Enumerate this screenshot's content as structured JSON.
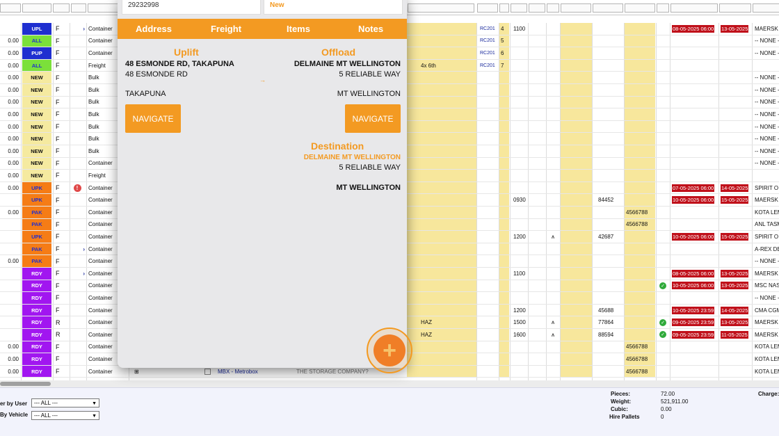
{
  "grid_rows": [
    {
      "amount": "",
      "status": "UPL",
      "status_bg": "#1f2fd0",
      "status_color": "#ffffff",
      "type": "F",
      "flag": "arrow",
      "category": "Container",
      "rc": "RC201",
      "n": "4",
      "time": "1100",
      "ref": "",
      "ref2": "",
      "check": false,
      "haz": false,
      "date1": "08-05-2025 06:00",
      "date2": "13-05-2025",
      "carrier": "MAERSK I"
    },
    {
      "amount": "0.00",
      "status": "ALL",
      "status_bg": "#7be03a",
      "status_color": "#1f2fd0",
      "type": "F",
      "flag": "",
      "category": "Container",
      "rc": "RC201",
      "n": "5",
      "time": "",
      "ref": "",
      "ref2": "",
      "check": false,
      "haz": false,
      "date1": "",
      "date2": "",
      "carrier": "-- NONE -"
    },
    {
      "amount": "0.00",
      "status": "PUP",
      "status_bg": "#1f2fd0",
      "status_color": "#ffffff",
      "type": "F",
      "flag": "",
      "category": "Container",
      "rc": "RC201",
      "n": "6",
      "time": "",
      "ref": "",
      "ref2": "",
      "check": false,
      "haz": false,
      "date1": "",
      "date2": "",
      "carrier": "-- NONE -"
    },
    {
      "amount": "0.00",
      "status": "ALL",
      "status_bg": "#7be03a",
      "status_color": "#1f2fd0",
      "type": "F",
      "flag": "",
      "category": "Freight",
      "extra": "4x 6th",
      "rc": "RC201",
      "n": "7",
      "time": "",
      "ref": "",
      "ref2": "",
      "check": false,
      "haz": false,
      "date1": "",
      "date2": "",
      "carrier": ""
    },
    {
      "amount": "0.00",
      "status": "NEW",
      "status_bg": "#f5eaa0",
      "status_color": "#111111",
      "type": "F",
      "flag": "",
      "category": "Bulk",
      "rc": "",
      "n": "",
      "time": "",
      "ref": "",
      "ref2": "",
      "check": false,
      "haz": false,
      "date1": "",
      "date2": "",
      "carrier": "-- NONE -"
    },
    {
      "amount": "0.00",
      "status": "NEW",
      "status_bg": "#f5eaa0",
      "status_color": "#111111",
      "type": "F",
      "flag": "",
      "category": "Bulk",
      "rc": "",
      "n": "",
      "time": "",
      "ref": "",
      "ref2": "",
      "check": false,
      "haz": false,
      "date1": "",
      "date2": "",
      "carrier": "-- NONE -"
    },
    {
      "amount": "0.00",
      "status": "NEW",
      "status_bg": "#f5eaa0",
      "status_color": "#111111",
      "type": "F",
      "flag": "",
      "category": "Bulk",
      "rc": "",
      "n": "",
      "time": "",
      "ref": "",
      "ref2": "",
      "check": false,
      "haz": false,
      "date1": "",
      "date2": "",
      "carrier": "-- NONE -"
    },
    {
      "amount": "0.00",
      "status": "NEW",
      "status_bg": "#f5eaa0",
      "status_color": "#111111",
      "type": "F",
      "flag": "",
      "category": "Bulk",
      "rc": "",
      "n": "",
      "time": "",
      "ref": "",
      "ref2": "",
      "check": false,
      "haz": false,
      "date1": "",
      "date2": "",
      "carrier": "-- NONE -"
    },
    {
      "amount": "0.00",
      "status": "NEW",
      "status_bg": "#f5eaa0",
      "status_color": "#111111",
      "type": "F",
      "flag": "",
      "category": "Bulk",
      "rc": "",
      "n": "",
      "time": "",
      "ref": "",
      "ref2": "",
      "check": false,
      "haz": false,
      "date1": "",
      "date2": "",
      "carrier": "-- NONE -"
    },
    {
      "amount": "0.00",
      "status": "NEW",
      "status_bg": "#f5eaa0",
      "status_color": "#111111",
      "type": "F",
      "flag": "",
      "category": "Bulk",
      "rc": "",
      "n": "",
      "time": "",
      "ref": "",
      "ref2": "",
      "check": false,
      "haz": false,
      "date1": "",
      "date2": "",
      "carrier": "-- NONE -"
    },
    {
      "amount": "0.00",
      "status": "NEW",
      "status_bg": "#f5eaa0",
      "status_color": "#111111",
      "type": "F",
      "flag": "",
      "category": "Bulk",
      "rc": "",
      "n": "",
      "time": "",
      "ref": "",
      "ref2": "",
      "check": false,
      "haz": false,
      "date1": "",
      "date2": "",
      "carrier": "-- NONE -"
    },
    {
      "amount": "0.00",
      "status": "NEW",
      "status_bg": "#f5eaa0",
      "status_color": "#111111",
      "type": "F",
      "flag": "",
      "category": "Container",
      "rc": "",
      "n": "",
      "time": "",
      "ref": "",
      "ref2": "",
      "check": false,
      "haz": false,
      "date1": "",
      "date2": "",
      "carrier": "-- NONE -"
    },
    {
      "amount": "0.00",
      "status": "NEW",
      "status_bg": "#f5eaa0",
      "status_color": "#111111",
      "type": "F",
      "flag": "",
      "category": "Freight",
      "rc": "",
      "n": "",
      "time": "",
      "ref": "",
      "ref2": "",
      "check": false,
      "haz": false,
      "date1": "",
      "date2": "",
      "carrier": ""
    },
    {
      "amount": "0.00",
      "status": "UPK",
      "status_bg": "#f57c16",
      "status_color": "#1f2fd0",
      "type": "F",
      "flag": "alert",
      "category": "Container",
      "rc": "",
      "n": "",
      "time": "",
      "ref": "",
      "ref2": "",
      "check": false,
      "haz": false,
      "date1": "07-05-2025 06:00",
      "date2": "14-05-2025",
      "carrier": "SPIRIT O"
    },
    {
      "amount": "",
      "status": "UPK",
      "status_bg": "#f57c16",
      "status_color": "#1f2fd0",
      "type": "F",
      "flag": "",
      "category": "Container",
      "rc": "",
      "n": "",
      "time": "0930",
      "ref": "84452",
      "ref2": "",
      "check": false,
      "haz": false,
      "date1": "10-05-2025 06:00",
      "date2": "15-05-2025",
      "carrier": "MAERSK V"
    },
    {
      "amount": "0.00",
      "status": "PAK",
      "status_bg": "#f57c16",
      "status_color": "#1f2fd0",
      "type": "F",
      "flag": "",
      "category": "Container",
      "rc": "",
      "n": "",
      "time": "",
      "ref": "",
      "ref2": "4566788",
      "check": false,
      "haz": false,
      "date1": "",
      "date2": "",
      "carrier": "KOTA LEM"
    },
    {
      "amount": "",
      "status": "PAK",
      "status_bg": "#f57c16",
      "status_color": "#1f2fd0",
      "type": "F",
      "flag": "",
      "category": "Container",
      "rc": "",
      "n": "",
      "time": "",
      "ref": "",
      "ref2": "4566788",
      "check": false,
      "haz": false,
      "date1": "",
      "date2": "",
      "carrier": "ANL TASM"
    },
    {
      "amount": "",
      "status": "UPK",
      "status_bg": "#f57c16",
      "status_color": "#1f2fd0",
      "type": "F",
      "flag": "",
      "category": "Container",
      "rc": "",
      "n": "",
      "time": "1200",
      "ref": "42687",
      "ref2": "",
      "check": false,
      "haz": true,
      "date1": "10-05-2025 06:00",
      "date2": "15-05-2025",
      "carrier": "SPIRIT O"
    },
    {
      "amount": "",
      "status": "PAK",
      "status_bg": "#f57c16",
      "status_color": "#1f2fd0",
      "type": "F",
      "flag": "arrow",
      "category": "Container",
      "rc": "",
      "n": "",
      "time": "",
      "ref": "",
      "ref2": "",
      "check": false,
      "haz": false,
      "date1": "",
      "date2": "",
      "carrier": "A-REX DE"
    },
    {
      "amount": "0.00",
      "status": "PAK",
      "status_bg": "#f57c16",
      "status_color": "#1f2fd0",
      "type": "F",
      "flag": "",
      "category": "Container",
      "rc": "",
      "n": "",
      "time": "",
      "ref": "",
      "ref2": "",
      "check": false,
      "haz": false,
      "date1": "",
      "date2": "",
      "carrier": "-- NONE -"
    },
    {
      "amount": "",
      "status": "RDY",
      "status_bg": "#a116f0",
      "status_color": "#ffffff",
      "type": "F",
      "flag": "arrow",
      "category": "Container",
      "rc": "",
      "n": "",
      "time": "1100",
      "ref": "",
      "ref2": "",
      "check": false,
      "haz": false,
      "date1": "08-05-2025 06:00",
      "date2": "13-05-2025",
      "carrier": "MAERSK I"
    },
    {
      "amount": "",
      "status": "RDY",
      "status_bg": "#a116f0",
      "status_color": "#ffffff",
      "type": "F",
      "flag": "",
      "category": "Container",
      "rc": "",
      "n": "",
      "time": "",
      "ref": "",
      "ref2": "",
      "check": true,
      "haz": false,
      "date1": "10-05-2025 06:00",
      "date2": "13-05-2025",
      "carrier": "MSC NASS"
    },
    {
      "amount": "",
      "status": "RDY",
      "status_bg": "#a116f0",
      "status_color": "#ffffff",
      "type": "F",
      "flag": "",
      "category": "Container",
      "rc": "",
      "n": "",
      "time": "",
      "ref": "",
      "ref2": "",
      "check": false,
      "haz": false,
      "date1": "",
      "date2": "",
      "carrier": "-- NONE -"
    },
    {
      "amount": "",
      "status": "RDY",
      "status_bg": "#a116f0",
      "status_color": "#ffffff",
      "type": "F",
      "flag": "",
      "category": "Container",
      "rc": "",
      "n": "",
      "time": "1200",
      "ref": "45688",
      "ref2": "",
      "check": false,
      "haz": false,
      "date1": "10-05-2025 23:59",
      "date2": "14-05-2025",
      "carrier": "CMA CGM"
    },
    {
      "amount": "",
      "status": "RDY",
      "status_bg": "#a116f0",
      "status_color": "#ffffff",
      "type": "R",
      "flag": "",
      "category": "Container",
      "extra": "HAZ",
      "rc": "",
      "n": "",
      "time": "1500",
      "ref": "77864",
      "ref2": "",
      "check": true,
      "haz": true,
      "date1": "09-05-2025 23:59",
      "date2": "13-05-2025",
      "carrier": "MAERSK I"
    },
    {
      "amount": "",
      "status": "RDY",
      "status_bg": "#a116f0",
      "status_color": "#ffffff",
      "type": "R",
      "flag": "",
      "category": "Container",
      "extra": "HAZ",
      "rc": "",
      "n": "",
      "time": "1600",
      "ref": "88594",
      "ref2": "",
      "check": true,
      "haz": true,
      "date1": "09-05-2025 23:59",
      "date2": "11-05-2025",
      "carrier": "MAERSK I"
    },
    {
      "amount": "0.00",
      "status": "RDY",
      "status_bg": "#a116f0",
      "status_color": "#ffffff",
      "type": "F",
      "flag": "",
      "category": "Container",
      "rc": "",
      "n": "",
      "time": "",
      "ref": "",
      "ref2": "4566788",
      "check": false,
      "haz": false,
      "date1": "",
      "date2": "",
      "carrier": "KOTA LEM"
    },
    {
      "amount": "0.00",
      "status": "RDY",
      "status_bg": "#a116f0",
      "status_color": "#ffffff",
      "type": "F",
      "flag": "",
      "category": "Container",
      "rc": "",
      "n": "",
      "time": "",
      "ref": "",
      "ref2": "4566788",
      "check": false,
      "haz": false,
      "date1": "",
      "date2": "",
      "carrier": "KOTA LEM"
    },
    {
      "amount": "0.00",
      "status": "RDY",
      "status_bg": "#a116f0",
      "status_color": "#ffffff",
      "type": "F",
      "flag": "",
      "category": "Container",
      "extra_mbx": "MBX - Metrobox",
      "extra_company": "THE STORAGE COMPANY?",
      "rc": "",
      "n": "",
      "time": "",
      "ref": "",
      "ref2": "4566788",
      "check": false,
      "haz": false,
      "date1": "",
      "date2": "",
      "carrier": "KOTA LEM"
    }
  ],
  "footer": {
    "filter_user_label": "er by User",
    "filter_user_value": "--- ALL ---",
    "filter_vehicle_label": "By Vehicle",
    "filter_vehicle_value": "--- ALL ---",
    "pieces_label": "Pieces:",
    "pieces_value": "72.00",
    "weight_label": "Weight:",
    "weight_value": "521,911.00",
    "cubic_label": "Cubic:",
    "cubic_value": "0.00",
    "hire_label": "Hire Pallets",
    "hire_value": "0",
    "charge_label": "Charge:"
  },
  "modal": {
    "top_field_left": "29232998",
    "top_field_right": "New",
    "tabs": [
      "Address",
      "Freight",
      "Items",
      "Notes"
    ],
    "uplift_title": "Uplift",
    "uplift_line1": "48 ESMONDE RD, TAKAPUNA",
    "uplift_line2": "48 ESMONDE RD",
    "uplift_city": "TAKAPUNA",
    "offload_title": "Offload",
    "offload_line1": "DELMAINE MT WELLINGTON",
    "offload_line2": "5 RELIABLE WAY",
    "offload_city": "MT WELLINGTON",
    "navigate_label": "NAVIGATE",
    "arrow": "→",
    "destination_title": "Destination",
    "destination_name": "DELMAINE MT WELLINGTON",
    "destination_line": "5 RELIABLE WAY",
    "destination_city": "MT WELLINGTON",
    "add_icon": "plus-icon"
  },
  "colors": {
    "accent": "#f39a22",
    "date_tag": "#c0101a",
    "stripe": "#f7e79c"
  }
}
